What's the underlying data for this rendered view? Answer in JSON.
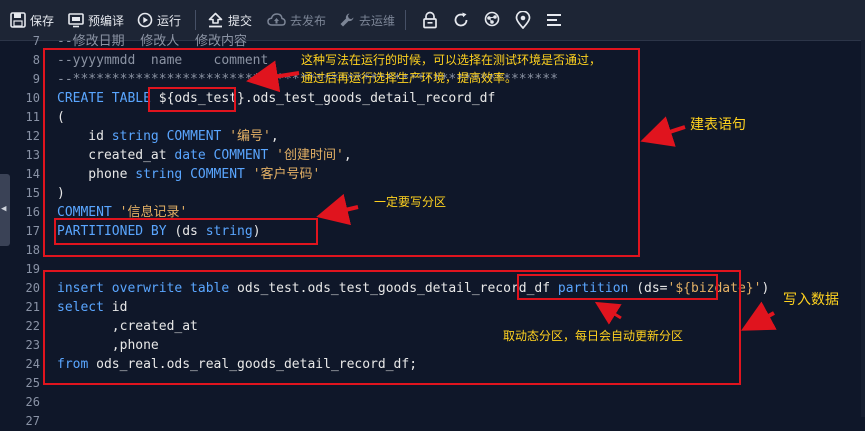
{
  "toolbar": {
    "save": "保存",
    "precompile": "预编译",
    "run": "运行",
    "submit": "提交",
    "publish": "去发布",
    "ops": "去运维"
  },
  "side_tab_glyph": "◀",
  "lines": [
    {
      "n": "7",
      "segments": [
        {
          "t": "--修改日期  修改人  修改内容",
          "c": "cm"
        }
      ]
    },
    {
      "n": "8",
      "segments": [
        {
          "t": "--yyyymmdd  name    comment",
          "c": "cm"
        }
      ]
    },
    {
      "n": "9",
      "segments": [
        {
          "t": "--**************************************************************",
          "c": "cm"
        }
      ]
    },
    {
      "n": "10",
      "segments": [
        {
          "t": "CREATE TABLE ",
          "c": "kw"
        },
        {
          "t": "${ods_test}.ods_test_goods_detail_record_df",
          "c": ""
        }
      ]
    },
    {
      "n": "11",
      "segments": [
        {
          "t": "(",
          "c": ""
        }
      ]
    },
    {
      "n": "12",
      "segments": [
        {
          "t": "    id ",
          "c": ""
        },
        {
          "t": "string",
          "c": "kw"
        },
        {
          "t": " COMMENT ",
          "c": "kw"
        },
        {
          "t": "'编号'",
          "c": "str"
        },
        {
          "t": ",",
          "c": ""
        }
      ]
    },
    {
      "n": "13",
      "segments": [
        {
          "t": "    created_at ",
          "c": ""
        },
        {
          "t": "date",
          "c": "kw"
        },
        {
          "t": " COMMENT ",
          "c": "kw"
        },
        {
          "t": "'创建时间'",
          "c": "str"
        },
        {
          "t": ",",
          "c": ""
        }
      ]
    },
    {
      "n": "14",
      "segments": [
        {
          "t": "    phone ",
          "c": ""
        },
        {
          "t": "string",
          "c": "kw"
        },
        {
          "t": " COMMENT ",
          "c": "kw"
        },
        {
          "t": "'客户号码'",
          "c": "str"
        }
      ]
    },
    {
      "n": "15",
      "segments": [
        {
          "t": ")",
          "c": ""
        }
      ]
    },
    {
      "n": "16",
      "segments": [
        {
          "t": "COMMENT ",
          "c": "kw"
        },
        {
          "t": "'信息记录'",
          "c": "str"
        }
      ]
    },
    {
      "n": "17",
      "segments": [
        {
          "t": "PARTITIONED BY",
          "c": "kw"
        },
        {
          "t": " (ds ",
          "c": ""
        },
        {
          "t": "string",
          "c": "kw"
        },
        {
          "t": ")",
          "c": ""
        }
      ]
    },
    {
      "n": "18",
      "segments": []
    },
    {
      "n": "19",
      "segments": []
    },
    {
      "n": "20",
      "segments": [
        {
          "t": "insert overwrite table ",
          "c": "kw"
        },
        {
          "t": "ods_test.ods_test_goods_detail_record_df ",
          "c": ""
        },
        {
          "t": "partition",
          "c": "kw"
        },
        {
          "t": " (ds=",
          "c": ""
        },
        {
          "t": "'${bizdate}'",
          "c": "str"
        },
        {
          "t": ")",
          "c": ""
        }
      ]
    },
    {
      "n": "21",
      "segments": [
        {
          "t": "select",
          "c": "kw"
        },
        {
          "t": " id",
          "c": ""
        }
      ]
    },
    {
      "n": "22",
      "segments": [
        {
          "t": "       ,created_at",
          "c": ""
        }
      ]
    },
    {
      "n": "23",
      "segments": [
        {
          "t": "       ,phone",
          "c": ""
        }
      ]
    },
    {
      "n": "24",
      "segments": [
        {
          "t": "from",
          "c": "kw"
        },
        {
          "t": " ods_real.ods_real_goods_detail_record_df;",
          "c": ""
        }
      ]
    },
    {
      "n": "25",
      "segments": []
    },
    {
      "n": "26",
      "segments": []
    },
    {
      "n": "27",
      "segments": []
    }
  ],
  "annotations": {
    "env_note_1": "这种写法在运行的时候，可以选择在测试环境是否通过，",
    "env_note_2": "通过后再运行选择生产环境，提高效率。",
    "create_table_label": "建表语句",
    "partition_required": "一定要写分区",
    "dynamic_partition": "取动态分区，每日会自动更新分区",
    "insert_data_label": "写入数据"
  }
}
